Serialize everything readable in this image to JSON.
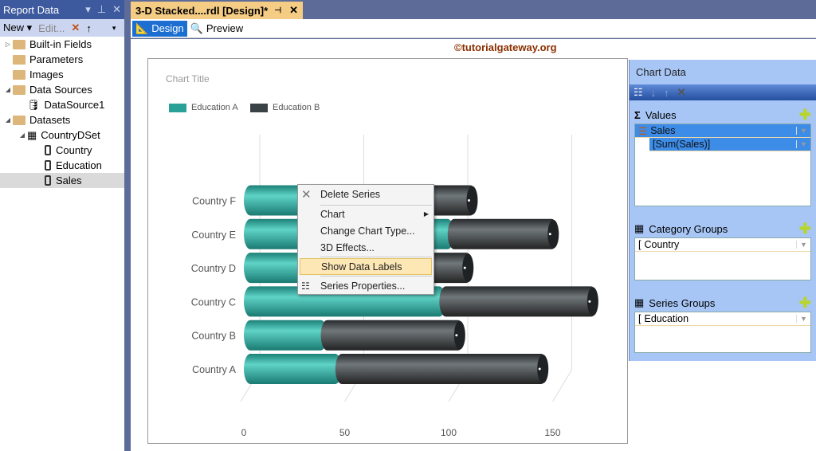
{
  "left_panel": {
    "title": "Report Data",
    "toolbar": {
      "new": "New",
      "edit": "Edit..."
    },
    "tree": [
      {
        "label": "Built-in Fields",
        "level": 0,
        "type": "folder",
        "arrow": "▷"
      },
      {
        "label": "Parameters",
        "level": 0,
        "type": "folder",
        "arrow": ""
      },
      {
        "label": "Images",
        "level": 0,
        "type": "folder",
        "arrow": ""
      },
      {
        "label": "Data Sources",
        "level": 0,
        "type": "folder",
        "arrow": "◢"
      },
      {
        "label": "DataSource1",
        "level": 1,
        "type": "db",
        "arrow": ""
      },
      {
        "label": "Datasets",
        "level": 0,
        "type": "folder",
        "arrow": "◢"
      },
      {
        "label": "CountryDSet",
        "level": 1,
        "type": "table",
        "arrow": "◢"
      },
      {
        "label": "Country",
        "level": 2,
        "type": "field",
        "arrow": ""
      },
      {
        "label": "Education",
        "level": 2,
        "type": "field",
        "arrow": ""
      },
      {
        "label": "Sales",
        "level": 2,
        "type": "field",
        "arrow": "",
        "selected": true
      }
    ]
  },
  "document": {
    "tab": "3-D Stacked....rdl [Design]*",
    "modes": [
      "Design",
      "Preview"
    ],
    "watermark": "©tutorialgateway.org"
  },
  "context_menu": {
    "items": [
      "Delete Series",
      "Chart",
      "Change Chart Type...",
      "3D Effects...",
      "Show Data Labels",
      "Series Properties..."
    ]
  },
  "chart_data_panel": {
    "title": "Chart Data",
    "values": {
      "label": "Values",
      "rows": [
        "Sales",
        "[Sum(Sales)]"
      ]
    },
    "category_groups": {
      "label": "Category Groups",
      "rows": [
        "Country"
      ]
    },
    "series_groups": {
      "label": "Series Groups",
      "rows": [
        "Education"
      ]
    }
  },
  "chart_data": {
    "type": "bar",
    "orientation": "horizontal",
    "stacked": true,
    "three_d": true,
    "title": "Chart Title",
    "categories": [
      "Country A",
      "Country B",
      "Country C",
      "Country D",
      "Country E",
      "Country F"
    ],
    "series": [
      {
        "name": "Education A",
        "color": "#2aa198",
        "values": [
          44,
          37,
          94,
          60,
          98,
          60
        ]
      },
      {
        "name": "Education B",
        "color": "#3b4245",
        "values": [
          99,
          66,
          73,
          47,
          50,
          49
        ]
      }
    ],
    "xticks": [
      "0",
      "50",
      "100",
      "150"
    ],
    "xlim": [
      0,
      150
    ],
    "legend": "top-left"
  }
}
